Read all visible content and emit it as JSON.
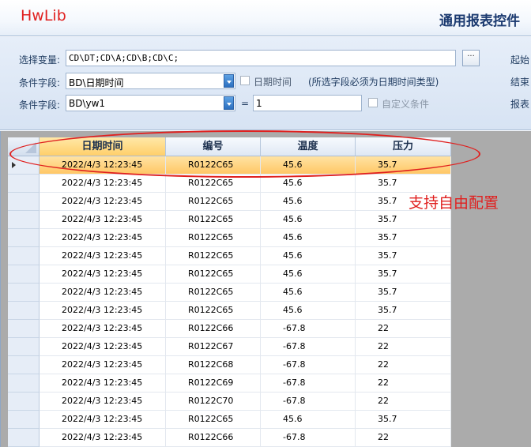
{
  "header": {
    "brand": "HwLib",
    "title": "通用报表控件"
  },
  "form": {
    "select_var_label": "选择变量:",
    "select_var_value": "CD\\DT;CD\\A;CD\\B;CD\\C;",
    "browse_label": "···",
    "cond1_label": "条件字段:",
    "cond1_value": "BD\\日期时间",
    "date_time_checkbox_label": "日期时间",
    "date_hint": "(所选字段必须为日期时间类型)",
    "cond2_label": "条件字段:",
    "cond2_value": "BD\\yw1",
    "equals": "=",
    "cond2_input": "1",
    "custom_checkbox_label": "自定义条件",
    "right_labels": [
      "起始",
      "结束",
      "报表"
    ]
  },
  "grid": {
    "columns": [
      "日期时间",
      "编号",
      "温度",
      "压力"
    ],
    "selected_row": 0,
    "rows": [
      [
        "2022/4/3 12:23:45",
        "R0122C65",
        "45.6",
        "35.7"
      ],
      [
        "2022/4/3 12:23:45",
        "R0122C65",
        "45.6",
        "35.7"
      ],
      [
        "2022/4/3 12:23:45",
        "R0122C65",
        "45.6",
        "35.7"
      ],
      [
        "2022/4/3 12:23:45",
        "R0122C65",
        "45.6",
        "35.7"
      ],
      [
        "2022/4/3 12:23:45",
        "R0122C65",
        "45.6",
        "35.7"
      ],
      [
        "2022/4/3 12:23:45",
        "R0122C65",
        "45.6",
        "35.7"
      ],
      [
        "2022/4/3 12:23:45",
        "R0122C65",
        "45.6",
        "35.7"
      ],
      [
        "2022/4/3 12:23:45",
        "R0122C65",
        "45.6",
        "35.7"
      ],
      [
        "2022/4/3 12:23:45",
        "R0122C65",
        "45.6",
        "35.7"
      ],
      [
        "2022/4/3 12:23:45",
        "R0122C66",
        "-67.8",
        "22"
      ],
      [
        "2022/4/3 12:23:45",
        "R0122C67",
        "-67.8",
        "22"
      ],
      [
        "2022/4/3 12:23:45",
        "R0122C68",
        "-67.8",
        "22"
      ],
      [
        "2022/4/3 12:23:45",
        "R0122C69",
        "-67.8",
        "22"
      ],
      [
        "2022/4/3 12:23:45",
        "R0122C70",
        "-67.8",
        "22"
      ],
      [
        "2022/4/3 12:23:45",
        "R0122C65",
        "45.6",
        "35.7"
      ],
      [
        "2022/4/3 12:23:45",
        "R0122C66",
        "-67.8",
        "22"
      ]
    ]
  },
  "annotation": "支持自由配置",
  "colors": {
    "brand": "#e0201f",
    "title": "#1b3a70",
    "selection": "#ffc766",
    "panel": "#d7e3f3",
    "grid_background": "#ababab"
  }
}
